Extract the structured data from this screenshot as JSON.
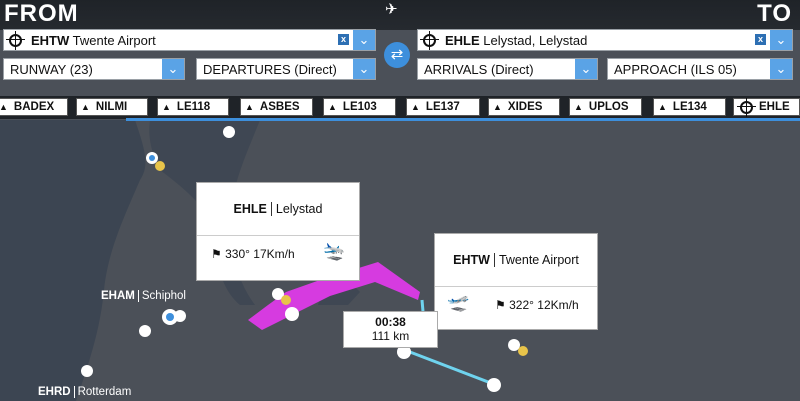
{
  "header": {
    "from_title": "FROM",
    "to_title": "TO"
  },
  "departure": {
    "code": "EHTW",
    "name": "Twente Airport",
    "runway": "RUNWAY (23)",
    "procedure": "DEPARTURES (Direct)"
  },
  "arrival": {
    "code": "EHLE",
    "name": "Lelystad, Lelystad",
    "procedure": "ARRIVALS (Direct)",
    "approach": "APPROACH (ILS 05)"
  },
  "waypoints": [
    "BADEX",
    "NILMI",
    "LE118",
    "ASBES",
    "LE103",
    "LE137",
    "XIDES",
    "UPLOS",
    "LE134",
    "EHLE"
  ],
  "cards": {
    "arrival": {
      "code": "EHLE",
      "name": "Lelystad",
      "wind": "330° 17Km/h"
    },
    "departure": {
      "code": "EHTW",
      "name": "Twente Airport",
      "wind": "322° 12Km/h"
    }
  },
  "route": {
    "time": "00:38",
    "distance": "111 km"
  },
  "map_labels": [
    {
      "code": "EHAM",
      "name": "Schiphol"
    },
    {
      "code": "EHRD",
      "name": "Rotterdam"
    }
  ],
  "colors": {
    "accent": "#3d8fdc",
    "route_magenta": "#d63be0",
    "route_cyan": "#6fd3ee",
    "land": "#4b5058",
    "water": "#3c4552"
  }
}
